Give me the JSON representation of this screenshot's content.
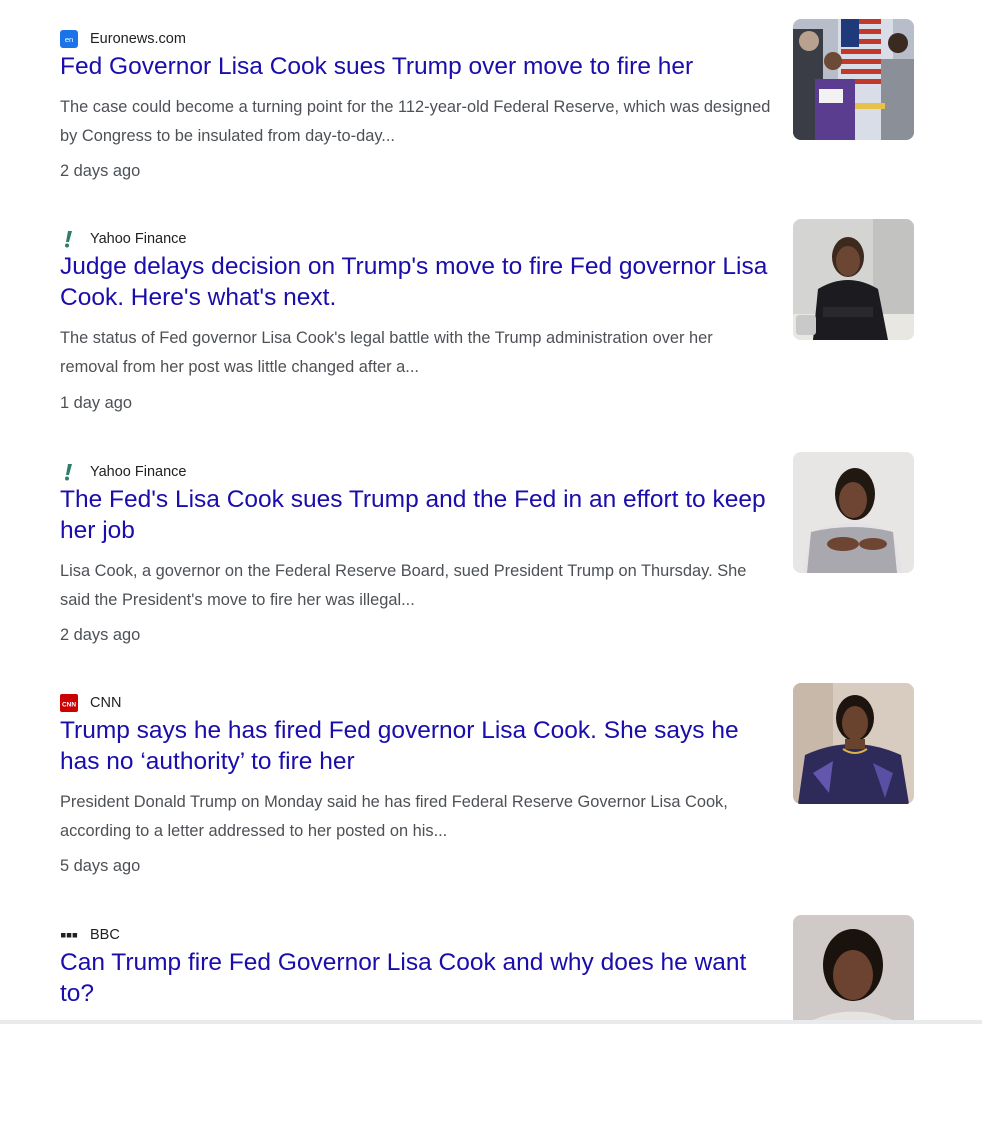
{
  "articles": [
    {
      "source": "Euronews.com",
      "icon_label": "en",
      "title": "Fed Governor Lisa Cook sues Trump over move to fire her",
      "snippet": "The case could become a turning point for the 112-year-old Federal Reserve, which was designed by Congress to be insulated from day-to-day...",
      "time": "2 days ago"
    },
    {
      "source": "Yahoo Finance",
      "icon_label": "",
      "title": "Judge delays decision on Trump's move to fire Fed governor Lisa Cook. Here's what's next.",
      "snippet": "The status of Fed governor Lisa Cook's legal battle with the Trump administration over her removal from her post was little changed after a...",
      "time": "1 day ago"
    },
    {
      "source": "Yahoo Finance",
      "icon_label": "",
      "title": "The Fed's Lisa Cook sues Trump and the Fed in an effort to keep her job",
      "snippet": "Lisa Cook, a governor on the Federal Reserve Board, sued President Trump on Thursday. She said the President's move to fire her was illegal...",
      "time": "2 days ago"
    },
    {
      "source": "CNN",
      "icon_label": "CNN",
      "title": "Trump says he has fired Fed governor Lisa Cook. She says he has no ‘authority’ to fire her",
      "snippet": "President Donald Trump on Monday said he has fired Federal Reserve Governor Lisa Cook, according to a letter addressed to her posted on his...",
      "time": "5 days ago"
    },
    {
      "source": "BBC",
      "icon_label": "",
      "title": "Can Trump fire Fed Governor Lisa Cook and why does he want to?",
      "snippet": "",
      "time": ""
    }
  ],
  "colors": {
    "headline": "#1a0dab",
    "snippet": "#4d5156",
    "source": "#202124",
    "euronews_icon": "#1a73e8",
    "yahoo_icon": "#2e7d6b",
    "cnn_icon": "#cc0000"
  },
  "icons": [
    "euronews-logo-icon",
    "yahoo-finance-icon",
    "cnn-logo-icon",
    "bbc-logo-icon"
  ]
}
